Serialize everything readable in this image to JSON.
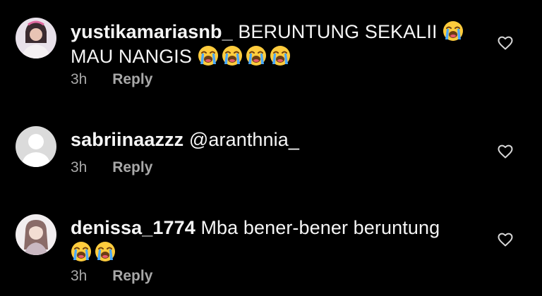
{
  "comments": [
    {
      "username": "yustikamariasnb_",
      "text": "BERUNTUNG SEKALII",
      "text_line2": "MAU NANGIS",
      "time": "3h",
      "reply_label": "Reply",
      "emoji_icon": "loudly-crying-face-icon"
    },
    {
      "username": "sabriinaazzz",
      "mention": "@aranthnia_",
      "time": "3h",
      "reply_label": "Reply"
    },
    {
      "username": "denissa_1774",
      "text": "Mba bener-bener beruntung",
      "time": "3h",
      "reply_label": "Reply",
      "emoji_icon": "loudly-crying-face-icon"
    }
  ],
  "colors": {
    "background": "#000000",
    "text": "#f5f5f5",
    "meta": "#a8a8a8",
    "icon": "#d8d8d8"
  }
}
